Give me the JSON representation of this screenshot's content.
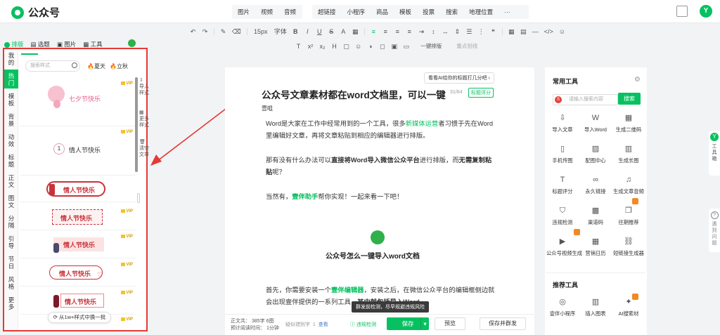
{
  "app": {
    "title": "公众号",
    "avatar_letter": "Y"
  },
  "top_tabs_a": [
    "图片",
    "视频",
    "音频"
  ],
  "top_tabs_b": [
    "超链接",
    "小程序",
    "商品",
    "模板",
    "投票",
    "搜索",
    "地理位置",
    "···"
  ],
  "toolbar": {
    "font_size": "15px",
    "font_label": "字体",
    "one_click_layout": "一键排版",
    "quick_divide": "重点划线"
  },
  "left_panel": {
    "top_tabs": [
      {
        "label": "排版",
        "active": true
      },
      {
        "label": "选题"
      },
      {
        "label": "图片"
      },
      {
        "label": "工具"
      }
    ],
    "vertical_tabs": [
      "我的",
      "热门",
      "模板",
      "背景",
      "动效",
      "标题",
      "正文",
      "图文",
      "分隔",
      "引导",
      "节日",
      "风格",
      "更多"
    ],
    "search_placeholder": "搜索样式",
    "hot_tags": [
      "夏天",
      "立秋"
    ],
    "styles": [
      {
        "text": "七夕节快乐"
      },
      {
        "text": "情人节快乐",
        "number": "1"
      },
      {
        "text": "情人节快乐"
      },
      {
        "text": "情人节快乐"
      },
      {
        "text": "情人节快乐"
      },
      {
        "text": "情人节快乐"
      },
      {
        "text": "情人节快乐"
      }
    ],
    "vip_label": "VIP",
    "side_mini": [
      "导入样式",
      "更多样式",
      "清空文章"
    ],
    "load_more": "从1w+样式中换一批"
  },
  "editor": {
    "ai_tip": "看看AI给你的标题打几分吧 ›",
    "title": "公众号文章素材都在word文档里，可以一键",
    "title_count": "31/64",
    "title_score": "标题评分",
    "author": "壹咀",
    "p1a": "Word是大家在工作中经常用到的一个工具，很多",
    "p1_hl": "新媒体运营",
    "p1b": "者习惯于先在Word里编辑好文章，再将文章粘贴到相应的编辑器进行排版。",
    "p2a": "那有没有什么办法可以",
    "p2_bold": "直接将Word导入微信公众平台",
    "p2b": "进行排版，而",
    "p2_bold2": "无需复制粘贴",
    "p2c": "呢？",
    "p3a": "当然有，",
    "p3_hl": "壹伴助手",
    "p3b": "帮你实现！一起来看一下吧！",
    "section_title": "公众号怎么一键导入word文档",
    "p4a": "首先，你需要安装一个",
    "p4_hl": "壹伴编辑器",
    "p4b": "，安装之后，在微信公众平台的编辑框侧边就会出现壹伴提供的一系列工具，",
    "p4c": "其中就包括导入Word。"
  },
  "bottom": {
    "word_count": "正文共：  385字 6图",
    "read_time": "预计阅读时间：  1分钟",
    "suspect": "疑似错别字",
    "suspect_count": "1",
    "check": "查看",
    "violation": "违规检测",
    "save": "保存",
    "preview": "预览",
    "save_publish": "保存并群发",
    "tooltip": "群发前检测，尽早规避违规风险"
  },
  "right_panel": {
    "title": "常用工具",
    "search_placeholder": "请输入搜索内容",
    "search_btn": "搜索",
    "tools": [
      {
        "label": "导入文章",
        "icon": "import-icon"
      },
      {
        "label": "导入Word",
        "icon": "word-icon"
      },
      {
        "label": "生成二维码",
        "icon": "qrcode-icon"
      },
      {
        "label": "手机传图",
        "icon": "phone-icon"
      },
      {
        "label": "配图中心",
        "icon": "image-icon"
      },
      {
        "label": "生成长图",
        "icon": "long-image-icon"
      },
      {
        "label": "标题评分",
        "icon": "title-icon"
      },
      {
        "label": "永久链接",
        "icon": "link-icon"
      },
      {
        "label": "生成文章音频",
        "icon": "audio-icon"
      },
      {
        "label": "违规检测",
        "icon": "shield-icon"
      },
      {
        "label": "渠道码",
        "icon": "channel-code-icon"
      },
      {
        "label": "往期推荐",
        "icon": "recommend-icon"
      },
      {
        "label": "公众号视频生成",
        "icon": "video-icon"
      },
      {
        "label": "营销日历",
        "icon": "calendar-icon"
      },
      {
        "label": "短链接生成器",
        "icon": "short-link-icon"
      }
    ],
    "title2": "推荐工具",
    "tools2": [
      {
        "label": "壹伴小程序",
        "icon": "miniapp-icon"
      },
      {
        "label": "插入图表",
        "icon": "chart-icon"
      },
      {
        "label": "AI搜索材",
        "icon": "ai-icon"
      }
    ]
  },
  "float_right": {
    "toolbox": "工具箱",
    "help": "遇到问题"
  }
}
